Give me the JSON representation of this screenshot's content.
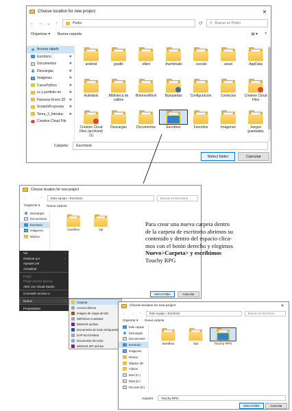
{
  "win1": {
    "title": "Choose location for new project",
    "address_path": "Pedro",
    "search_placeholder": "Buscar en Pedro",
    "organize_label": "Organizar ▾",
    "new_folder_label": "Nueva carpeta",
    "sidebar": [
      {
        "label": "Acceso rápido",
        "icon": "star",
        "pin": false,
        "selected": true
      },
      {
        "label": "Escritorio",
        "icon": "desk",
        "pin": true
      },
      {
        "label": "Documentos",
        "icon": "doc",
        "pin": true
      },
      {
        "label": "Descargas",
        "icon": "down",
        "pin": true
      },
      {
        "label": "Imágenes",
        "icon": "img",
        "pin": true
      },
      {
        "label": "CursoPython",
        "icon": "folder",
        "pin": true
      },
      {
        "label": "cv y portfolio-im",
        "icon": "folder",
        "pin": true
      },
      {
        "label": "Facturas Enero 20",
        "icon": "folder",
        "pin": true
      },
      {
        "label": "ScratchProyectos",
        "icon": "folder",
        "pin": true
      },
      {
        "label": "Tema_3_Introduc",
        "icon": "folder",
        "pin": true
      },
      {
        "label": "Creative Cloud File",
        "icon": "cloud",
        "pin": false
      }
    ],
    "folders": [
      {
        "label": "android"
      },
      {
        "label": "gradle"
      },
      {
        "label": ".idlerc"
      },
      {
        "label": ".thumbnails"
      },
      {
        "label": ".vscode"
      },
      {
        "label": "ansel"
      },
      {
        "label": "AppData"
      },
      {
        "label": "Autodesk"
      },
      {
        "label": "Biblioteca de calibre"
      },
      {
        "label": "BotonesMovil"
      },
      {
        "label": "Búsquedas"
      },
      {
        "label": "Configuración"
      },
      {
        "label": "Contactos"
      },
      {
        "label": "Creative Cloud Files"
      },
      {
        "label": "Creative Cloud Files (archived) (1)"
      },
      {
        "label": "Descargas"
      },
      {
        "label": "Documentos"
      },
      {
        "label": "Escritorio"
      },
      {
        "label": "Favoritos"
      },
      {
        "label": "Imágenes"
      },
      {
        "label": "Juegos guardados"
      }
    ],
    "folder_field_label": "Carpeta:",
    "folder_field_value": "Escritorio",
    "select_button": "Select folder",
    "cancel_button": "Cancelar"
  },
  "win2": {
    "title": "Choose location for new project",
    "address_path": "Este equipo  ›  Escritorio",
    "search_placeholder": "Buscar en Escritorio",
    "organize_label": "Organizar ▾",
    "new_folder_label": "Nueva carpeta",
    "sidebar": [
      {
        "label": "Descargas",
        "icon": "down"
      },
      {
        "label": "Documentos",
        "icon": "doc"
      },
      {
        "label": "Escritorio",
        "icon": "desk",
        "selected": true
      },
      {
        "label": "Imágenes",
        "icon": "img"
      },
      {
        "label": "Música",
        "icon": "folder"
      }
    ],
    "folders": [
      {
        "label": "Sandbox"
      },
      {
        "label": "Sqt"
      }
    ],
    "select_button": "Select folder",
    "cancel_button": "Cancelar",
    "context_menu": [
      {
        "label": "Ver",
        "chevron": true
      },
      {
        "label": "Ordenar por",
        "chevron": true
      },
      {
        "label": "Agrupar por",
        "chevron": true
      },
      {
        "label": "Actualizar"
      },
      {
        "sep": true
      },
      {
        "label": "Pegar",
        "dim": true
      },
      {
        "label": "Pegar acceso directo",
        "dim": true
      },
      {
        "label": "Abrir con Visual Studio"
      },
      {
        "sep": true
      },
      {
        "label": "Conceder acceso a",
        "chevron": true
      },
      {
        "sep": true
      },
      {
        "label": "Nuevo",
        "chevron": true,
        "hl": true
      },
      {
        "sep": true
      },
      {
        "label": "Propiedades"
      }
    ],
    "submenu": [
      {
        "label": "Carpeta",
        "icon": "f",
        "hl": true
      },
      {
        "label": "Acceso directo",
        "icon": ""
      },
      {
        "label": "Imagen de mapa de bits",
        "icon": "p"
      },
      {
        "label": "SMTDrive Container",
        "icon": ""
      },
      {
        "label": "WinRAR archive",
        "icon": "z"
      },
      {
        "label": "Documento de texto enriquecido",
        "icon": "w"
      },
      {
        "label": "DAP EU Erstkrat",
        "icon": ""
      },
      {
        "label": "Documento de texto",
        "icon": ""
      },
      {
        "label": "WinRAR ZIP archive",
        "icon": "z"
      }
    ]
  },
  "annotation": {
    "line1": "Para crear una nueva carpeta dentro",
    "line2": "de la carpeta de escritorio abrimos su",
    "line3": "contenido y dentro del espacio clica-",
    "line4": "mos con el botón derecho y elegimos",
    "line5": "Nuevo>Carpeta> y escribimos",
    "line6": "Touchy RPG"
  },
  "win3": {
    "title": "Choose location for new project",
    "address_path": "Este equipo  ›  Escritorio",
    "search_placeholder": "Buscar en Escritorio",
    "organize_label": "Organizar ▾",
    "new_folder_label": "Nueva carpeta",
    "sidebar": [
      {
        "label": "Este equipo",
        "icon": "desk"
      },
      {
        "label": "Descargas",
        "icon": "down"
      },
      {
        "label": "Documentos",
        "icon": "doc"
      },
      {
        "label": "Escritorio",
        "icon": "desk",
        "selected": true
      },
      {
        "label": "Imágenes",
        "icon": "img"
      },
      {
        "label": "Música",
        "icon": "folder"
      },
      {
        "label": "Objetos 3D",
        "icon": "folder"
      },
      {
        "label": "Vídeos",
        "icon": "folder"
      },
      {
        "label": "Boot (C:)",
        "icon": "doc"
      },
      {
        "label": "Data (D:)",
        "icon": "doc"
      },
      {
        "label": "Recover (E:)",
        "icon": "doc"
      }
    ],
    "folders": [
      {
        "label": "Sandbox"
      },
      {
        "label": "Sqt"
      },
      {
        "label": "Touchy RPG"
      }
    ],
    "folder_field_label": "Carpeta:",
    "folder_field_value": "Touchy RPG",
    "select_button": "Select folder",
    "cancel_button": "Cancelar"
  }
}
